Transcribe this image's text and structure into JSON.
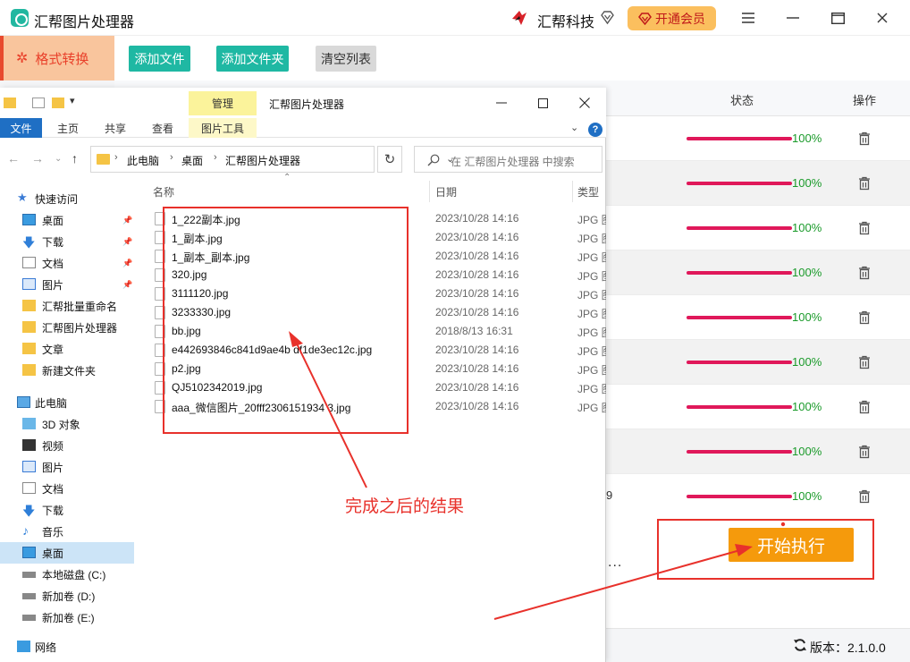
{
  "app": {
    "title": "汇帮图片处理器",
    "brand": "汇帮科技",
    "vip_button": "开通会员",
    "window_controls": [
      "menu-icon",
      "minimize-icon",
      "maximize-icon",
      "close-icon"
    ]
  },
  "nav": {
    "active_label": "格式转换"
  },
  "toolbar": {
    "add_file": "添加文件",
    "add_folder": "添加文件夹",
    "clear_list": "清空列表"
  },
  "table": {
    "headers": {
      "status": "状态",
      "action": "操作"
    },
    "rows": [
      {
        "progress": 1.0,
        "label": "100%"
      },
      {
        "progress": 1.0,
        "label": "100%"
      },
      {
        "progress": 1.0,
        "label": "100%"
      },
      {
        "progress": 1.0,
        "label": "100%"
      },
      {
        "progress": 1.0,
        "label": "100%"
      },
      {
        "progress": 1.0,
        "label": "100%"
      },
      {
        "progress": 1.0,
        "label": "100%"
      },
      {
        "progress": 1.0,
        "label": "100%"
      },
      {
        "progress": 1.0,
        "label": "100%"
      }
    ],
    "partial_text": "9",
    "ellipsis": "..."
  },
  "start_button": "开始执行",
  "version": "版本：2.1.0.0",
  "explorer": {
    "manage_tab": "管理",
    "title": "汇帮图片处理器",
    "ribbon": {
      "file": "文件",
      "home": "主页",
      "share": "共享",
      "view": "查看",
      "picture_tools": "图片工具"
    },
    "breadcrumb": [
      "此电脑",
      "桌面",
      "汇帮图片处理器"
    ],
    "search_placeholder": "在 汇帮图片处理器 中搜索",
    "columns": {
      "name": "名称",
      "date": "日期",
      "type": "类型"
    },
    "nav_items": [
      {
        "label": "快速访问",
        "icon": "star-icon",
        "indent": false,
        "pinned": false
      },
      {
        "label": "桌面",
        "icon": "desktop-icon",
        "indent": true,
        "pinned": true
      },
      {
        "label": "下载",
        "icon": "download-icon",
        "indent": true,
        "pinned": true
      },
      {
        "label": "文档",
        "icon": "document-icon",
        "indent": true,
        "pinned": true
      },
      {
        "label": "图片",
        "icon": "picture-icon",
        "indent": true,
        "pinned": true
      },
      {
        "label": "汇帮批量重命名",
        "icon": "folder-icon",
        "indent": true,
        "pinned": false
      },
      {
        "label": "汇帮图片处理器",
        "icon": "folder-icon",
        "indent": true,
        "pinned": false
      },
      {
        "label": "文章",
        "icon": "folder-icon",
        "indent": true,
        "pinned": false
      },
      {
        "label": "新建文件夹",
        "icon": "folder-icon",
        "indent": true,
        "pinned": false
      },
      {
        "label": "此电脑",
        "icon": "computer-icon",
        "indent": false,
        "pinned": false
      },
      {
        "label": "3D 对象",
        "icon": "cube-icon",
        "indent": true,
        "pinned": false
      },
      {
        "label": "视频",
        "icon": "video-icon",
        "indent": true,
        "pinned": false
      },
      {
        "label": "图片",
        "icon": "picture-icon",
        "indent": true,
        "pinned": false
      },
      {
        "label": "文档",
        "icon": "document-icon",
        "indent": true,
        "pinned": false
      },
      {
        "label": "下载",
        "icon": "download-icon",
        "indent": true,
        "pinned": false
      },
      {
        "label": "音乐",
        "icon": "music-icon",
        "indent": true,
        "pinned": false
      },
      {
        "label": "桌面",
        "icon": "desktop-icon",
        "indent": true,
        "pinned": false,
        "selected": true
      },
      {
        "label": "本地磁盘 (C:)",
        "icon": "drive-icon",
        "indent": true,
        "pinned": false
      },
      {
        "label": "新加卷 (D:)",
        "icon": "drive-icon",
        "indent": true,
        "pinned": false
      },
      {
        "label": "新加卷 (E:)",
        "icon": "drive-icon",
        "indent": true,
        "pinned": false
      },
      {
        "label": "网络",
        "icon": "network-icon",
        "indent": false,
        "pinned": false
      }
    ],
    "files": [
      {
        "name": "1_222副本.jpg",
        "date": "2023/10/28 14:16",
        "type": "JPG 图"
      },
      {
        "name": "1_副本.jpg",
        "date": "2023/10/28 14:16",
        "type": "JPG 图"
      },
      {
        "name": "1_副本_副本.jpg",
        "date": "2023/10/28 14:16",
        "type": "JPG 图"
      },
      {
        "name": "320.jpg",
        "date": "2023/10/28 14:16",
        "type": "JPG 图"
      },
      {
        "name": "3111120.jpg",
        "date": "2023/10/28 14:16",
        "type": "JPG 图"
      },
      {
        "name": "3233330.jpg",
        "date": "2023/10/28 14:16",
        "type": "JPG 图"
      },
      {
        "name": "bb.jpg",
        "date": "2018/8/13 16:31",
        "type": "JPG 图"
      },
      {
        "name": "e442693846c841d9ae4b   df1de3ec12c.jpg",
        "date": "2023/10/28 14:16",
        "type": "JPG 图"
      },
      {
        "name": "p2.jpg",
        "date": "2023/10/28 14:16",
        "type": "JPG 图"
      },
      {
        "name": "QJ5102342019.jpg",
        "date": "2023/10/28 14:16",
        "type": "JPG 图"
      },
      {
        "name": "aaa_微信图片_20fff2306151934  3.jpg",
        "date": "2023/10/28 14:16",
        "type": "JPG 图"
      }
    ]
  },
  "annotation": {
    "text": "完成之后的结果",
    "color": "#e8312b"
  },
  "colors": {
    "accent_teal": "#1fb8a3",
    "progress": "#e0185a",
    "percent": "#1a9a2a",
    "start": "#f59a0c"
  }
}
